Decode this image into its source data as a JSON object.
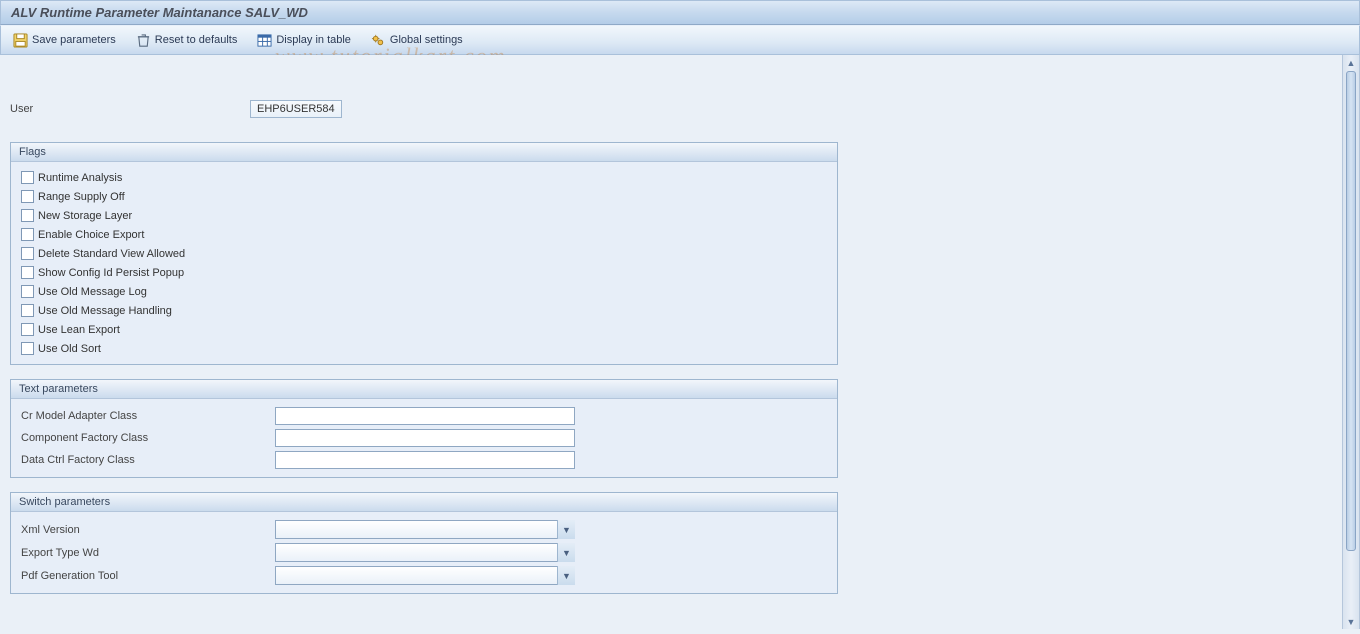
{
  "title": "ALV Runtime Parameter Maintanance SALV_WD",
  "toolbar": {
    "save_label": "Save parameters",
    "reset_label": "Reset to defaults",
    "display_label": "Display in table",
    "settings_label": "Global settings"
  },
  "watermark": "www.tutorialkart.com",
  "user": {
    "label": "User",
    "value": "EHP6USER584"
  },
  "groups": {
    "flags": {
      "title": "Flags",
      "items": [
        "Runtime Analysis",
        "Range Supply Off",
        "New Storage Layer",
        "Enable Choice Export",
        "Delete Standard View Allowed",
        "Show Config Id Persist Popup",
        "Use Old Message Log",
        "Use Old Message Handling",
        "Use Lean Export",
        "Use Old Sort"
      ]
    },
    "text_params": {
      "title": "Text parameters",
      "items": [
        {
          "label": "Cr Model Adapter Class",
          "value": ""
        },
        {
          "label": "Component Factory Class",
          "value": ""
        },
        {
          "label": "Data Ctrl Factory Class",
          "value": ""
        }
      ]
    },
    "switch_params": {
      "title": "Switch parameters",
      "items": [
        {
          "label": "Xml Version",
          "value": ""
        },
        {
          "label": "Export Type Wd",
          "value": ""
        },
        {
          "label": "Pdf Generation Tool",
          "value": ""
        }
      ]
    }
  }
}
